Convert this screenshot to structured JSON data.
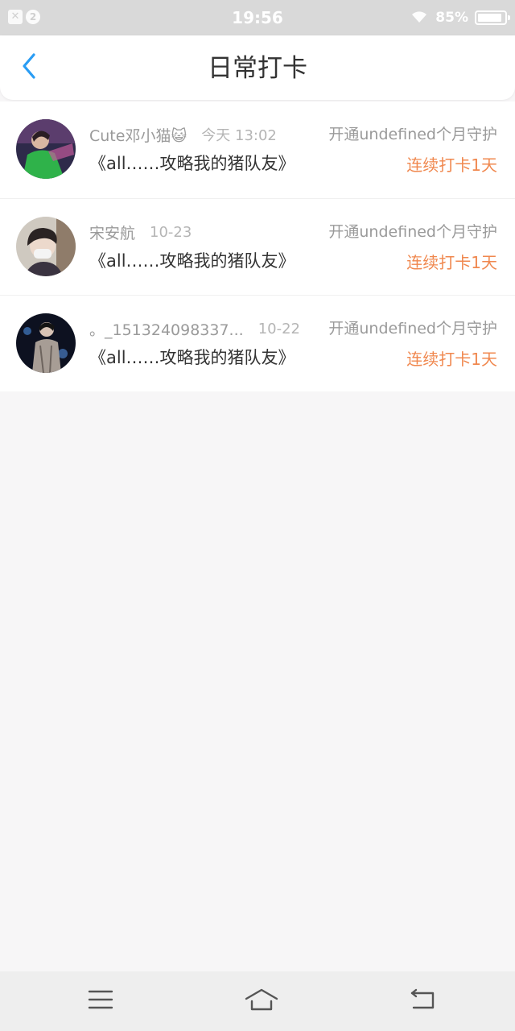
{
  "status_bar": {
    "notification_count": "2",
    "time": "19:56",
    "battery_percent": "85%",
    "battery_level": 0.85
  },
  "header": {
    "title": "日常打卡"
  },
  "checkins": [
    {
      "username": "Cute邓小猫😺",
      "time": "今天 13:02",
      "guard_text": "开通undefined个月守护",
      "book": "《all……攻略我的猪队友》",
      "streak": "连续打卡1天"
    },
    {
      "username": "宋安航",
      "time": "10-23",
      "guard_text": "开通undefined个月守护",
      "book": "《all……攻略我的猪队友》",
      "streak": "连续打卡1天"
    },
    {
      "username": "。_151324098337...",
      "time": "10-22",
      "guard_text": "开通undefined个月守护",
      "book": "《all……攻略我的猪队友》",
      "streak": "连续打卡1天"
    }
  ],
  "colors": {
    "accent_blue": "#2a9df4",
    "streak_orange": "#f0884f",
    "muted_text": "#9a9a9a",
    "primary_text": "#333333"
  },
  "icons": [
    "close-notification-icon",
    "wifi-icon",
    "battery-icon",
    "back-chevron-icon",
    "menu-icon",
    "home-icon",
    "back-icon"
  ]
}
